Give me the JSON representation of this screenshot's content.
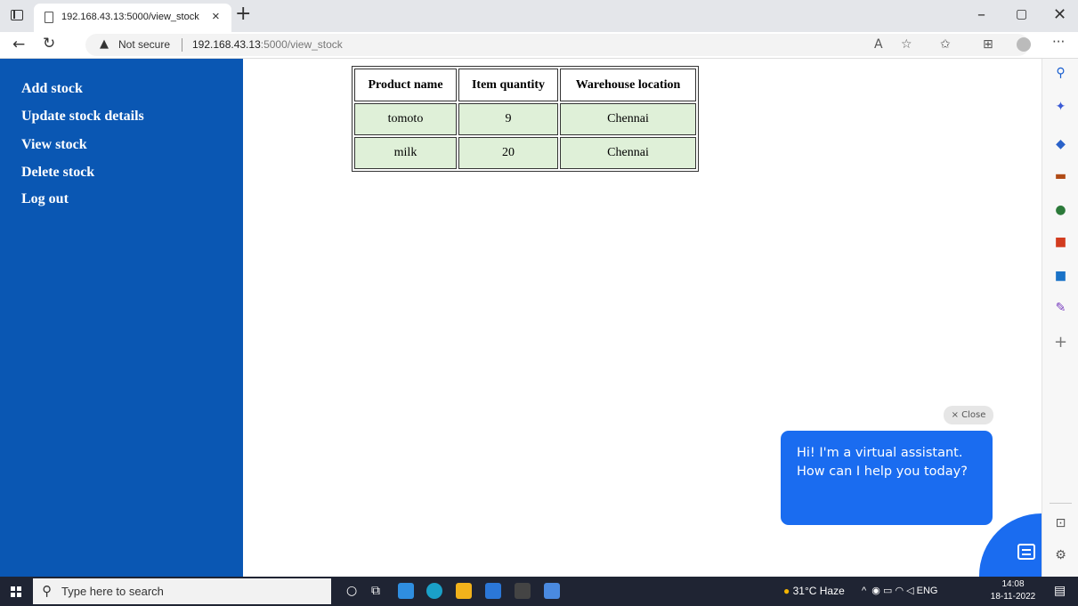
{
  "browser": {
    "tab_title": "192.168.43.13:5000/view_stock",
    "tab_close": "×",
    "new_tab": "+",
    "security_label": "Not secure",
    "url_host": "192.168.43.13",
    "url_path": ":5000/view_stock"
  },
  "sidebar": {
    "items": [
      {
        "label": "Add stock"
      },
      {
        "label": "Update stock details"
      },
      {
        "label": "View stock"
      },
      {
        "label": "Delete stock"
      },
      {
        "label": "Log out"
      }
    ]
  },
  "stock_table": {
    "headers": [
      "Product name",
      "Item quantity",
      "Warehouse location"
    ],
    "rows": [
      [
        "tomoto",
        "9",
        "Chennai"
      ],
      [
        "milk",
        "20",
        "Chennai"
      ]
    ]
  },
  "chat": {
    "close_label": "× Close",
    "message": "Hi! I'm a virtual assistant. How can I help you today?"
  },
  "taskbar": {
    "search_placeholder": "Type here to search",
    "weather": "31°C  Haze",
    "language": "ENG",
    "time": "14:08",
    "date": "18-11-2022"
  },
  "colors": {
    "sidebar_bg": "#0a57b3",
    "table_cell_bg": "#dff0d8",
    "chat_blue": "#1a6cf0"
  }
}
